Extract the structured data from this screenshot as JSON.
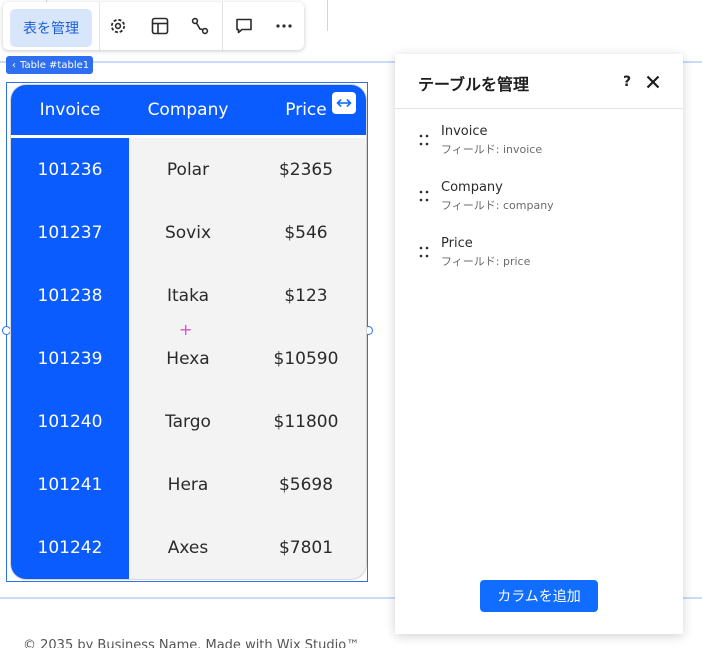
{
  "toolbar": {
    "manage_label": "表を管理",
    "icons": [
      "gear-icon",
      "layout-icon",
      "connect-icon",
      "comment-icon",
      "more-icon"
    ]
  },
  "element_tag": {
    "label": "Table #table1"
  },
  "table": {
    "headers": [
      "Invoice",
      "Company",
      "Price"
    ],
    "rows": [
      [
        "101236",
        "Polar",
        "$2365"
      ],
      [
        "101237",
        "Sovix",
        "$546"
      ],
      [
        "101238",
        "Itaka",
        "$123"
      ],
      [
        "101239",
        "Hexa",
        "$10590"
      ],
      [
        "101240",
        "Targo",
        "$11800"
      ],
      [
        "101241",
        "Hera",
        "$5698"
      ],
      [
        "101242",
        "Axes",
        "$7801"
      ]
    ],
    "header_color": "#0a5cff",
    "body_color": "#f3f3f3"
  },
  "plus_mark": "+",
  "footer": {
    "text": "© 2035 by Business Name. Made with Wix Studio™"
  },
  "panel": {
    "title": "テーブルを管理",
    "help": "?",
    "columns": [
      {
        "name": "Invoice",
        "field": "フィールド: invoice"
      },
      {
        "name": "Company",
        "field": "フィールド: company"
      },
      {
        "name": "Price",
        "field": "フィールド: price"
      }
    ],
    "add_column_label": "カラムを追加"
  },
  "accent_color": "#116dff"
}
